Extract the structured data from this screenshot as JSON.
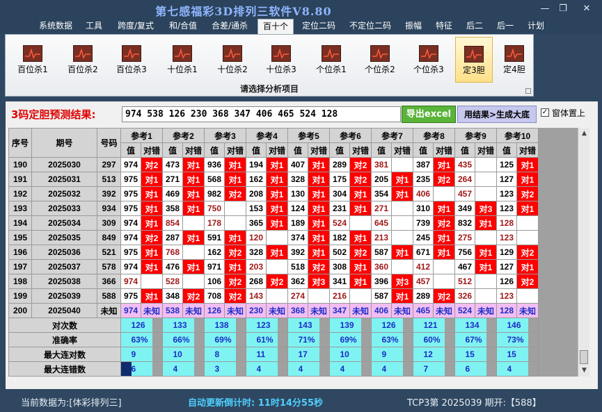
{
  "window": {
    "title": "第七感福彩3D排列三软件V8.80",
    "minimize": "—",
    "restore": "❐",
    "close": "✕"
  },
  "menu": [
    "系统数据",
    "工具",
    "跨度/复式",
    "和/合值",
    "合差/通杀",
    "百十个",
    "定位二码",
    "不定位二码",
    "振幅",
    "特征",
    "后二",
    "后一",
    "计划"
  ],
  "active_menu": "百十个",
  "ribbon": {
    "buttons": [
      "百位杀1",
      "百位杀2",
      "百位杀3",
      "十位杀1",
      "十位杀2",
      "十位杀3",
      "个位杀1",
      "个位杀2",
      "个位杀3",
      "定3胆",
      "定4胆"
    ],
    "active": "定3胆",
    "group_label": "请选择分析项目"
  },
  "prediction": {
    "label": "3码定胆预测结果:",
    "value": "974 538 126 230 368 347 406 465 524 128",
    "export_button": "导出excel",
    "generate_button": "用结果>生成大底",
    "on_top_checked": true,
    "on_top_label": "窗体置上"
  },
  "table": {
    "headers": {
      "seq": "序号",
      "period": "期号",
      "number": "号码",
      "refs": [
        "参考1",
        "参考2",
        "参考3",
        "参考4",
        "参考5",
        "参考6",
        "参考7",
        "参考8",
        "参考9",
        "参考10"
      ],
      "value": "值",
      "result": "对错"
    },
    "rows": [
      {
        "seq": "190",
        "period": "2025030",
        "num": "297",
        "cells": [
          [
            "974",
            "对2"
          ],
          [
            "473",
            "对1"
          ],
          [
            "936",
            "对1"
          ],
          [
            "194",
            "对1"
          ],
          [
            "407",
            "对1"
          ],
          [
            "289",
            "对2"
          ],
          [
            "381",
            ""
          ],
          [
            "387",
            "对1"
          ],
          [
            "435",
            ""
          ],
          [
            "125",
            "对1"
          ]
        ]
      },
      {
        "seq": "191",
        "period": "2025031",
        "num": "513",
        "cells": [
          [
            "975",
            "对1"
          ],
          [
            "271",
            "对1"
          ],
          [
            "568",
            "对1"
          ],
          [
            "162",
            "对1"
          ],
          [
            "328",
            "对1"
          ],
          [
            "175",
            "对2"
          ],
          [
            "205",
            "对1"
          ],
          [
            "235",
            "对2"
          ],
          [
            "264",
            ""
          ],
          [
            "127",
            "对1"
          ]
        ]
      },
      {
        "seq": "192",
        "period": "2025032",
        "num": "392",
        "cells": [
          [
            "975",
            "对1"
          ],
          [
            "469",
            "对1"
          ],
          [
            "982",
            "对2"
          ],
          [
            "208",
            "对1"
          ],
          [
            "130",
            "对1"
          ],
          [
            "304",
            "对1"
          ],
          [
            "354",
            "对1"
          ],
          [
            "406",
            ""
          ],
          [
            "457",
            ""
          ],
          [
            "123",
            "对2"
          ]
        ]
      },
      {
        "seq": "193",
        "period": "2025033",
        "num": "934",
        "cells": [
          [
            "975",
            "对1"
          ],
          [
            "358",
            "对1"
          ],
          [
            "750",
            ""
          ],
          [
            "153",
            "对1"
          ],
          [
            "124",
            "对1"
          ],
          [
            "231",
            "对1"
          ],
          [
            "271",
            ""
          ],
          [
            "310",
            "对1"
          ],
          [
            "349",
            "对3"
          ],
          [
            "123",
            "对1"
          ]
        ]
      },
      {
        "seq": "194",
        "period": "2025034",
        "num": "309",
        "cells": [
          [
            "974",
            "对1"
          ],
          [
            "854",
            ""
          ],
          [
            "178",
            ""
          ],
          [
            "365",
            "对1"
          ],
          [
            "189",
            "对1"
          ],
          [
            "524",
            ""
          ],
          [
            "645",
            ""
          ],
          [
            "739",
            "对2"
          ],
          [
            "832",
            "对1"
          ],
          [
            "128",
            ""
          ]
        ]
      },
      {
        "seq": "195",
        "period": "2025035",
        "num": "849",
        "cells": [
          [
            "974",
            "对2"
          ],
          [
            "287",
            "对1"
          ],
          [
            "591",
            "对1"
          ],
          [
            "120",
            ""
          ],
          [
            "374",
            "对1"
          ],
          [
            "182",
            "对1"
          ],
          [
            "213",
            ""
          ],
          [
            "245",
            "对1"
          ],
          [
            "275",
            ""
          ],
          [
            "123",
            ""
          ]
        ]
      },
      {
        "seq": "196",
        "period": "2025036",
        "num": "521",
        "cells": [
          [
            "975",
            "对1"
          ],
          [
            "768",
            ""
          ],
          [
            "162",
            "对2"
          ],
          [
            "328",
            "对1"
          ],
          [
            "392",
            "对1"
          ],
          [
            "502",
            "对2"
          ],
          [
            "587",
            "对1"
          ],
          [
            "671",
            "对1"
          ],
          [
            "756",
            "对1"
          ],
          [
            "129",
            "对2"
          ]
        ]
      },
      {
        "seq": "197",
        "period": "2025037",
        "num": "578",
        "cells": [
          [
            "974",
            "对1"
          ],
          [
            "476",
            "对1"
          ],
          [
            "971",
            "对1"
          ],
          [
            "203",
            ""
          ],
          [
            "518",
            "对2"
          ],
          [
            "308",
            "对1"
          ],
          [
            "360",
            ""
          ],
          [
            "412",
            ""
          ],
          [
            "467",
            "对1"
          ],
          [
            "127",
            "对1"
          ]
        ]
      },
      {
        "seq": "198",
        "period": "2025038",
        "num": "366",
        "cells": [
          [
            "974",
            ""
          ],
          [
            "528",
            ""
          ],
          [
            "106",
            "对2"
          ],
          [
            "268",
            "对2"
          ],
          [
            "362",
            "对3"
          ],
          [
            "341",
            "对1"
          ],
          [
            "396",
            "对3"
          ],
          [
            "457",
            ""
          ],
          [
            "512",
            ""
          ],
          [
            "126",
            "对2"
          ]
        ]
      },
      {
        "seq": "199",
        "period": "2025039",
        "num": "588",
        "cells": [
          [
            "975",
            "对1"
          ],
          [
            "348",
            "对2"
          ],
          [
            "708",
            "对2"
          ],
          [
            "143",
            ""
          ],
          [
            "274",
            ""
          ],
          [
            "216",
            ""
          ],
          [
            "587",
            "对1"
          ],
          [
            "289",
            "对2"
          ],
          [
            "326",
            ""
          ],
          [
            "123",
            ""
          ]
        ]
      }
    ],
    "current": {
      "seq": "200",
      "period": "2025040",
      "num": "未知",
      "cells": [
        [
          "974",
          "未知"
        ],
        [
          "538",
          "未知"
        ],
        [
          "126",
          "未知"
        ],
        [
          "230",
          "未知"
        ],
        [
          "368",
          "未知"
        ],
        [
          "347",
          "未知"
        ],
        [
          "406",
          "未知"
        ],
        [
          "465",
          "未知"
        ],
        [
          "524",
          "未知"
        ],
        [
          "128",
          "未知"
        ]
      ]
    },
    "stats": [
      {
        "label": "对次数",
        "values": [
          "126",
          "133",
          "138",
          "123",
          "143",
          "139",
          "126",
          "121",
          "134",
          "146"
        ]
      },
      {
        "label": "准确率",
        "values": [
          "63%",
          "66%",
          "69%",
          "61%",
          "71%",
          "69%",
          "63%",
          "60%",
          "67%",
          "73%"
        ]
      },
      {
        "label": "最大连对数",
        "values": [
          "9",
          "10",
          "8",
          "11",
          "17",
          "10",
          "9",
          "12",
          "15",
          "15"
        ]
      },
      {
        "label": "最大连错数",
        "values": [
          "6",
          "4",
          "3",
          "4",
          "4",
          "4",
          "4",
          "7",
          "6",
          "4"
        ]
      }
    ]
  },
  "status": {
    "data_label": "当前数据为:[体彩排列三]",
    "countdown": "自动更新倒计时: 11时14分55秒",
    "issue": "TCP3第 2025039 期开:【588】"
  },
  "colors": {
    "hit": "#ff0000",
    "miss_value": "#a01818",
    "current_row": "#f3bdf2",
    "stats_row": "#7ff3f2",
    "title": "#8fb6ff",
    "pred_label": "#e00000"
  }
}
